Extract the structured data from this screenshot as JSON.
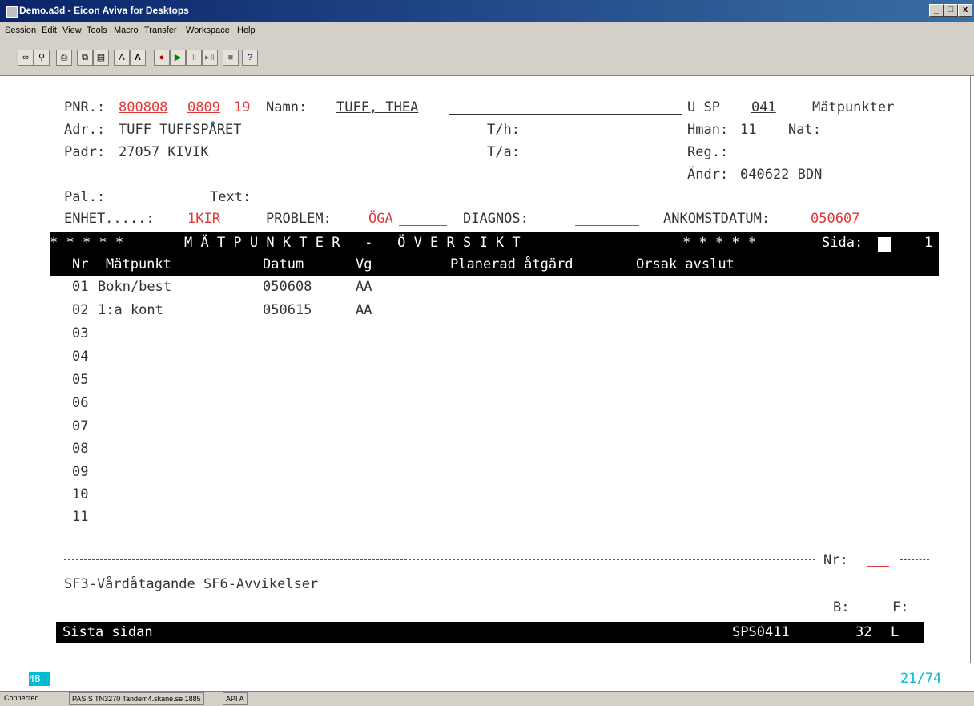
{
  "window": {
    "title": "Demo.a3d - Eicon Aviva for Desktops"
  },
  "window_buttons": [
    "_",
    "□",
    "x"
  ],
  "menu": [
    "Session",
    "Edit",
    "View",
    "Tools",
    "Macro",
    "Transfer",
    "Workspace",
    "Help"
  ],
  "toolbar_icons": [
    "connect-icon",
    "disconnect-icon",
    "print-icon",
    "copy-icon",
    "paste-icon",
    "font-smaller-icon",
    "font-larger-icon",
    "record-icon",
    "play-icon",
    "pause-icon",
    "step-icon",
    "stop-icon",
    "help-icon"
  ],
  "header": {
    "pnr_label": "PNR.:",
    "pnr_part1": "800808",
    "pnr_part2": "0809",
    "pnr_part3": "19",
    "namn_label": "Namn:",
    "namn_value": "TUFF, THEA",
    "screen_code_prefix": "U SP",
    "screen_code": "041",
    "screen_name": "Mätpunkter",
    "adr_label": "Adr.:",
    "adr_value": "TUFF TUFFSPÅRET",
    "th_label": "T/h:",
    "hman_label": "Hman:",
    "hman_value": "11",
    "nat_label": "Nat:",
    "padr_label": "Padr:",
    "padr_value": "27057 KIVIK",
    "ta_label": "T/a:",
    "reg_label": "Reg.:",
    "andr_label": "Ändr:",
    "andr_value": "040622 BDN",
    "pal_label": "Pal.:",
    "text_label": "Text:",
    "enhet_label": "ENHET.....:",
    "enhet_value": "1KIR",
    "problem_label": "PROBLEM:",
    "problem_value": "ÖGA",
    "diagnos_label": "DIAGNOS:",
    "ankomst_label": "ANKOMSTDATUM:",
    "ankomst_value": "050607"
  },
  "banner": {
    "stars_left": "* * * * *",
    "title": "M Ä T P U N K T E R   -   Ö V E R S I K T",
    "stars_right": "* * * * *",
    "sida_label": "Sida:",
    "sida_value": "1"
  },
  "table": {
    "columns": [
      "Nr",
      "Mätpunkt",
      "Datum",
      "Vg",
      "Planerad åtgärd",
      "Orsak avslut"
    ],
    "rows": [
      {
        "nr": "01",
        "matpunkt": "Bokn/best",
        "datum": "050608",
        "vg": "AA"
      },
      {
        "nr": "02",
        "matpunkt": "1:a kont",
        "datum": "050615",
        "vg": "AA"
      },
      {
        "nr": "03",
        "matpunkt": "",
        "datum": "",
        "vg": ""
      },
      {
        "nr": "04",
        "matpunkt": "",
        "datum": "",
        "vg": ""
      },
      {
        "nr": "05",
        "matpunkt": "",
        "datum": "",
        "vg": ""
      },
      {
        "nr": "06",
        "matpunkt": "",
        "datum": "",
        "vg": ""
      },
      {
        "nr": "07",
        "matpunkt": "",
        "datum": "",
        "vg": ""
      },
      {
        "nr": "08",
        "matpunkt": "",
        "datum": "",
        "vg": ""
      },
      {
        "nr": "09",
        "matpunkt": "",
        "datum": "",
        "vg": ""
      },
      {
        "nr": "10",
        "matpunkt": "",
        "datum": "",
        "vg": ""
      },
      {
        "nr": "11",
        "matpunkt": "",
        "datum": "",
        "vg": ""
      }
    ]
  },
  "footer": {
    "nr_label": "Nr:",
    "function_keys": "SF3-Vårdåtagande SF6-Avvikelser",
    "b_label": "B:",
    "f_label": "F:",
    "message": "Sista sidan",
    "program_id": "SPS0411",
    "count": "32",
    "mode": "L",
    "cursor_pos": "21/74",
    "indicator": "4B"
  },
  "status": {
    "connection": "Connected.",
    "session_info": "PASIS  TN3270  Tandem4.skane.se  1885",
    "session_id": "API A"
  },
  "colors": {
    "field_red": "#e03a3a",
    "cursor_cyan": "#00bcd4",
    "title_blue": "#0a246a"
  }
}
